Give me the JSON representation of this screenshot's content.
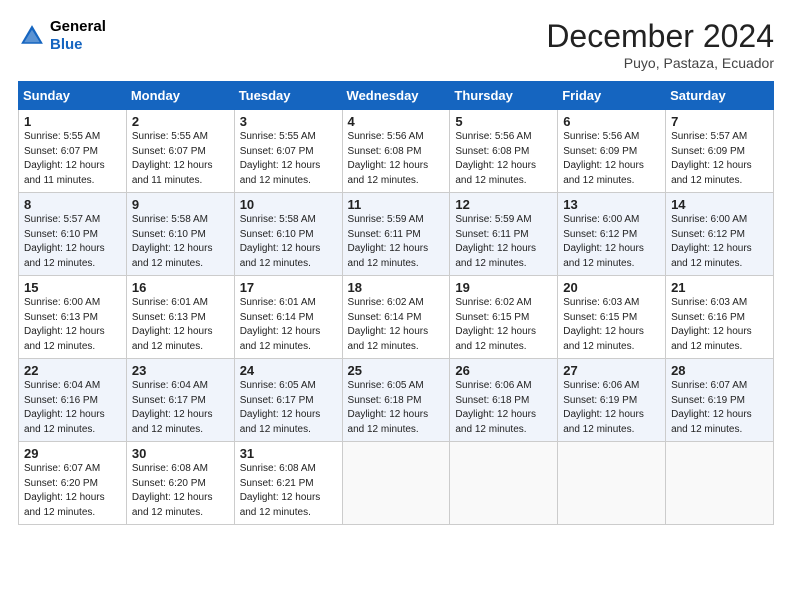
{
  "header": {
    "logo_line1": "General",
    "logo_line2": "Blue",
    "month_title": "December 2024",
    "location": "Puyo, Pastaza, Ecuador"
  },
  "days_of_week": [
    "Sunday",
    "Monday",
    "Tuesday",
    "Wednesday",
    "Thursday",
    "Friday",
    "Saturday"
  ],
  "weeks": [
    [
      {
        "day": "1",
        "sunrise": "5:55 AM",
        "sunset": "6:07 PM",
        "daylight": "12 hours and 11 minutes."
      },
      {
        "day": "2",
        "sunrise": "5:55 AM",
        "sunset": "6:07 PM",
        "daylight": "12 hours and 11 minutes."
      },
      {
        "day": "3",
        "sunrise": "5:55 AM",
        "sunset": "6:07 PM",
        "daylight": "12 hours and 12 minutes."
      },
      {
        "day": "4",
        "sunrise": "5:56 AM",
        "sunset": "6:08 PM",
        "daylight": "12 hours and 12 minutes."
      },
      {
        "day": "5",
        "sunrise": "5:56 AM",
        "sunset": "6:08 PM",
        "daylight": "12 hours and 12 minutes."
      },
      {
        "day": "6",
        "sunrise": "5:56 AM",
        "sunset": "6:09 PM",
        "daylight": "12 hours and 12 minutes."
      },
      {
        "day": "7",
        "sunrise": "5:57 AM",
        "sunset": "6:09 PM",
        "daylight": "12 hours and 12 minutes."
      }
    ],
    [
      {
        "day": "8",
        "sunrise": "5:57 AM",
        "sunset": "6:10 PM",
        "daylight": "12 hours and 12 minutes."
      },
      {
        "day": "9",
        "sunrise": "5:58 AM",
        "sunset": "6:10 PM",
        "daylight": "12 hours and 12 minutes."
      },
      {
        "day": "10",
        "sunrise": "5:58 AM",
        "sunset": "6:10 PM",
        "daylight": "12 hours and 12 minutes."
      },
      {
        "day": "11",
        "sunrise": "5:59 AM",
        "sunset": "6:11 PM",
        "daylight": "12 hours and 12 minutes."
      },
      {
        "day": "12",
        "sunrise": "5:59 AM",
        "sunset": "6:11 PM",
        "daylight": "12 hours and 12 minutes."
      },
      {
        "day": "13",
        "sunrise": "6:00 AM",
        "sunset": "6:12 PM",
        "daylight": "12 hours and 12 minutes."
      },
      {
        "day": "14",
        "sunrise": "6:00 AM",
        "sunset": "6:12 PM",
        "daylight": "12 hours and 12 minutes."
      }
    ],
    [
      {
        "day": "15",
        "sunrise": "6:00 AM",
        "sunset": "6:13 PM",
        "daylight": "12 hours and 12 minutes."
      },
      {
        "day": "16",
        "sunrise": "6:01 AM",
        "sunset": "6:13 PM",
        "daylight": "12 hours and 12 minutes."
      },
      {
        "day": "17",
        "sunrise": "6:01 AM",
        "sunset": "6:14 PM",
        "daylight": "12 hours and 12 minutes."
      },
      {
        "day": "18",
        "sunrise": "6:02 AM",
        "sunset": "6:14 PM",
        "daylight": "12 hours and 12 minutes."
      },
      {
        "day": "19",
        "sunrise": "6:02 AM",
        "sunset": "6:15 PM",
        "daylight": "12 hours and 12 minutes."
      },
      {
        "day": "20",
        "sunrise": "6:03 AM",
        "sunset": "6:15 PM",
        "daylight": "12 hours and 12 minutes."
      },
      {
        "day": "21",
        "sunrise": "6:03 AM",
        "sunset": "6:16 PM",
        "daylight": "12 hours and 12 minutes."
      }
    ],
    [
      {
        "day": "22",
        "sunrise": "6:04 AM",
        "sunset": "6:16 PM",
        "daylight": "12 hours and 12 minutes."
      },
      {
        "day": "23",
        "sunrise": "6:04 AM",
        "sunset": "6:17 PM",
        "daylight": "12 hours and 12 minutes."
      },
      {
        "day": "24",
        "sunrise": "6:05 AM",
        "sunset": "6:17 PM",
        "daylight": "12 hours and 12 minutes."
      },
      {
        "day": "25",
        "sunrise": "6:05 AM",
        "sunset": "6:18 PM",
        "daylight": "12 hours and 12 minutes."
      },
      {
        "day": "26",
        "sunrise": "6:06 AM",
        "sunset": "6:18 PM",
        "daylight": "12 hours and 12 minutes."
      },
      {
        "day": "27",
        "sunrise": "6:06 AM",
        "sunset": "6:19 PM",
        "daylight": "12 hours and 12 minutes."
      },
      {
        "day": "28",
        "sunrise": "6:07 AM",
        "sunset": "6:19 PM",
        "daylight": "12 hours and 12 minutes."
      }
    ],
    [
      {
        "day": "29",
        "sunrise": "6:07 AM",
        "sunset": "6:20 PM",
        "daylight": "12 hours and 12 minutes."
      },
      {
        "day": "30",
        "sunrise": "6:08 AM",
        "sunset": "6:20 PM",
        "daylight": "12 hours and 12 minutes."
      },
      {
        "day": "31",
        "sunrise": "6:08 AM",
        "sunset": "6:21 PM",
        "daylight": "12 hours and 12 minutes."
      },
      null,
      null,
      null,
      null
    ]
  ],
  "labels": {
    "sunrise": "Sunrise:",
    "sunset": "Sunset:",
    "daylight": "Daylight: "
  }
}
